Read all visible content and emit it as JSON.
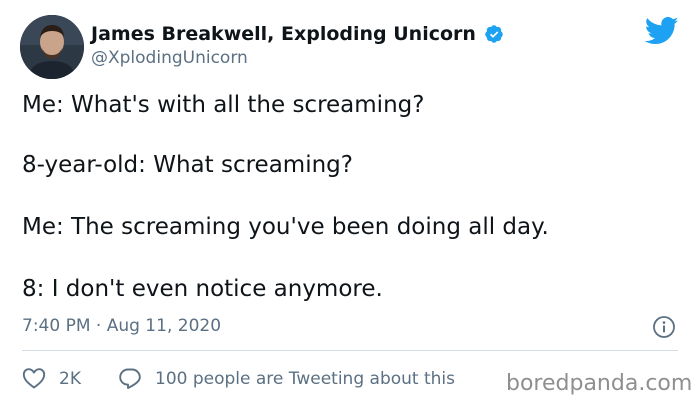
{
  "author": {
    "display_name": "James Breakwell, Exploding Unicorn",
    "handle": "@XplodingUnicorn",
    "verified": true,
    "avatar_icon": "avatar-photo"
  },
  "tweet": {
    "lines": [
      "Me: What's with all the screaming?",
      "8-year-old: What screaming?",
      "Me: The screaming you've been doing all day.",
      "8: I don't even notice anymore."
    ],
    "timestamp": "7:40 PM · Aug 11, 2020"
  },
  "engagement": {
    "likes": "2K",
    "tweeting_text": "100 people are Tweeting about this"
  },
  "watermark": "boredpanda.com",
  "icons": {
    "verified": "verified-badge-icon",
    "twitter": "twitter-bird-icon",
    "info": "info-icon",
    "like": "heart-icon",
    "reply": "speech-bubble-icon"
  },
  "colors": {
    "twitter_blue": "#1da1f2",
    "text": "#0f1419",
    "muted": "#5b7083",
    "divider": "#d4dde4",
    "watermark": "#8f8f8f"
  }
}
